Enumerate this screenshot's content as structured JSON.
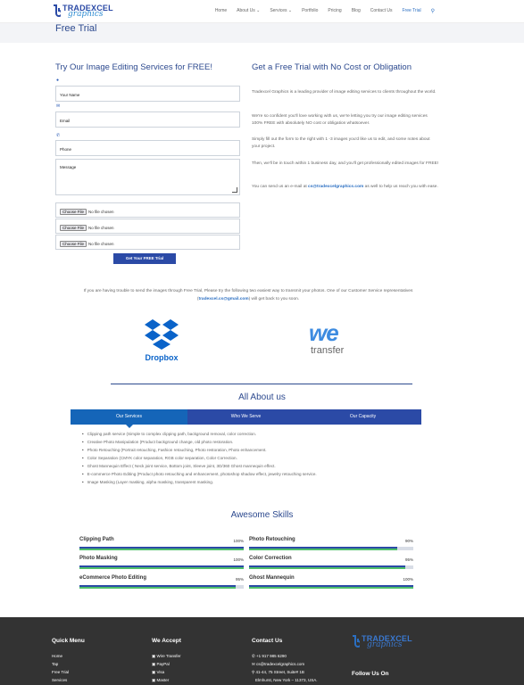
{
  "header": {
    "logo_line1": "TRADEXCEL",
    "logo_line2": "graphics",
    "nav": [
      "Home",
      "About Us ⌄",
      "Services ⌄",
      "Portfolio",
      "Pricing",
      "Blog",
      "Contact Us",
      "Free Trial"
    ]
  },
  "page_title": "Free Trial",
  "form": {
    "heading": "Try Our Image Editing Services for FREE!",
    "name_placeholder": "Your Name",
    "email_placeholder": "Email",
    "phone_placeholder": "Phone",
    "message_placeholder": "Message",
    "file_button": "Choose File",
    "file_status": "No file chosen",
    "submit": "Get Your FREE Trial"
  },
  "info": {
    "heading": "Get a Free Trial with No Cost or Obligation",
    "p1": "Tradexcel Graphics is a leading provider of image editing services to clients throughout the world.",
    "p2": "We're so confident you'll love working with us, we're letting you try our image editing services 100% FREE with absolutely NO cost or obligation whatsoever.",
    "p3": "Simply fill out the form to the right with 1 -3 images you'd like us to edit, and some notes about your project.",
    "p4": "Then, we'll be in touch within 1 business day, and you'll get professionally edited images for FREE!",
    "p5_pre": "You can send us an e-mail at ",
    "p5_email": "cs@tradexcelgraphics.com",
    "p5_post": " as well to help us reach you with ease."
  },
  "note": {
    "pre": "If you are having trouble to send the images through Free Trial, Please try the following two easiest way to transmit your photos. One of our Customer Service representatives (",
    "email": "tradexcel.cs@gmail.com",
    "post": ") will get back to you soon."
  },
  "dropbox_label": "Dropbox",
  "wetransfer": {
    "we": "we",
    "transfer": "transfer"
  },
  "about": {
    "title": "All About us",
    "tabs": [
      "Our Services",
      "Who We Serve",
      "Our Capacity"
    ],
    "items": [
      "Clipping path service (Simple to complex clipping path, background removal, color correction.",
      "Creative Photo Manipulation (Product background change, old photo restoration.",
      "Photo Retouching (Portrait retouching, Fashion retouching, Photo restoration, Photo enhancement.",
      "Color Separation (CMYK color separation, RGB color separation, Color Correction.",
      "Ghost Mannequin Effect ( Neck joint service, Bottom joint, Sleeve joint, 3D/360 Ghost mannequin effect.",
      "E-commerce Photo Editing (Product photo retouching and enhancement, photoshop shadow effect, jewelry retouching service.",
      "Image Masking (Layer masking, alpha masking, transparent masking."
    ]
  },
  "skills": {
    "title": "Awesome Skills",
    "items": [
      {
        "name": "Clipping Path",
        "pct": "100%",
        "value": 1.0
      },
      {
        "name": "Photo Retouching",
        "pct": "90%",
        "value": 0.9
      },
      {
        "name": "Photo Masking",
        "pct": "100%",
        "value": 1.0
      },
      {
        "name": "Color Correction",
        "pct": "95%",
        "value": 0.95
      },
      {
        "name": "eCommerce Photo Editing",
        "pct": "95%",
        "value": 0.95
      },
      {
        "name": "Ghost Mannequin",
        "pct": "100%",
        "value": 1.0
      }
    ]
  },
  "footer": {
    "quick_menu": "Quick Menu",
    "quick_items": [
      "Home",
      "Tap",
      "Free Trial",
      "Services"
    ],
    "we_accept": "We Accept",
    "accept_items": [
      "Wire Transfer",
      "PayPal",
      "Visa",
      "Master"
    ],
    "contact": "Contact Us",
    "contact_items": [
      "+1 917 985 6290",
      "cs@tradexcelgraphics.com",
      "41-44, 75 Street, Suite# 1B",
      "Elmhurst, New York – 11373, USA."
    ],
    "follow": "Follow Us On"
  },
  "colors": {
    "brand": "#2b4aa6",
    "accent": "#2b6fc2",
    "green": "#4fc06b"
  }
}
